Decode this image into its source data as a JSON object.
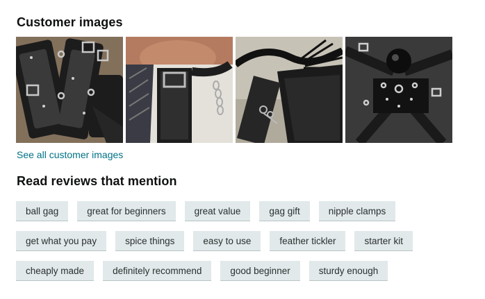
{
  "customer_images": {
    "heading": "Customer images",
    "see_all_link": "See all customer images",
    "thumbnails": [
      {
        "label": "customer-image-1"
      },
      {
        "label": "customer-image-2"
      },
      {
        "label": "customer-image-3"
      },
      {
        "label": "customer-image-4"
      }
    ]
  },
  "mentions": {
    "heading": "Read reviews that mention",
    "rows": [
      [
        "ball gag",
        "great for beginners",
        "great value",
        "gag gift",
        "nipple clamps"
      ],
      [
        "get what you pay",
        "spice things",
        "easy to use",
        "feather tickler",
        "starter kit"
      ],
      [
        "cheaply made",
        "definitely recommend",
        "good beginner",
        "sturdy enough"
      ]
    ]
  },
  "colors": {
    "link": "#007185",
    "chip_bg": "#e1e9ea",
    "text": "#0f1111"
  }
}
